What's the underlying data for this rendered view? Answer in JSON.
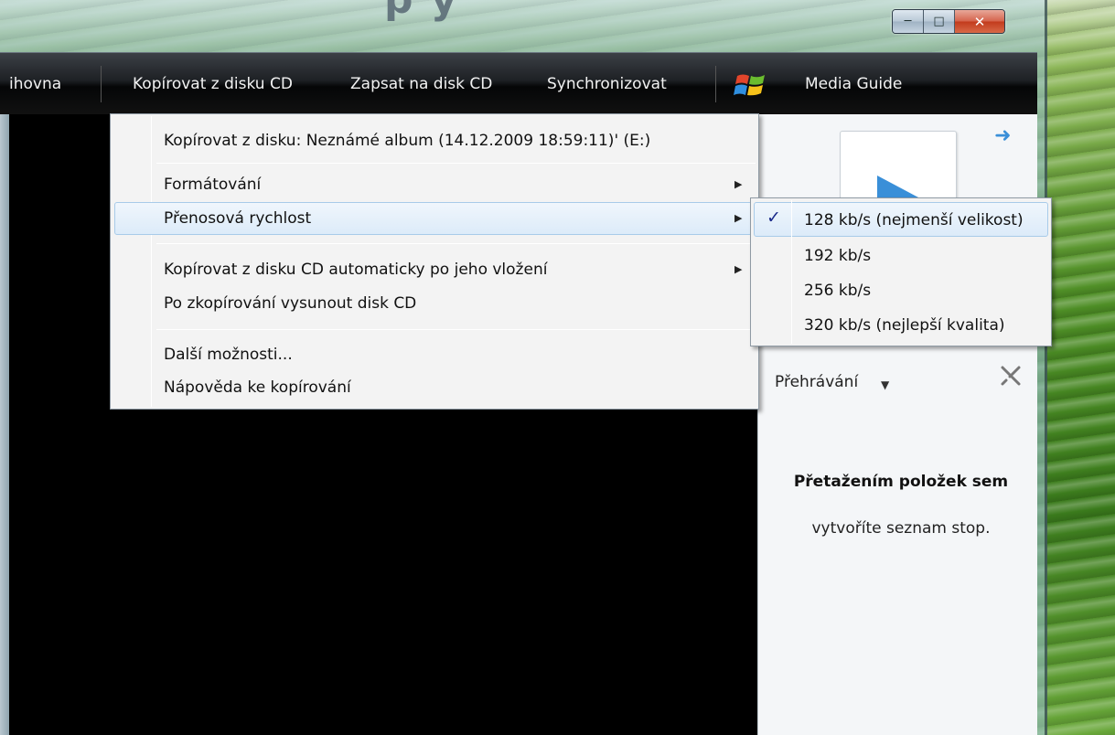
{
  "banner": {
    "title": "p  y"
  },
  "window": {
    "controls": {
      "minimize_icon": "minimize-icon",
      "maximize_icon": "maximize-icon",
      "close_icon": "close-icon"
    }
  },
  "toolbar": {
    "items": [
      {
        "label": "ihovna"
      },
      {
        "label": "Kopírovat z disku CD"
      },
      {
        "label": "Zapsat na disk CD"
      },
      {
        "label": "Synchronizovat"
      },
      {
        "label": "Media Guide"
      }
    ]
  },
  "rip_menu": {
    "items": [
      {
        "label": "Kopírovat z disku: Neznámé album (14.12.2009 18:59:11)' (E:)",
        "has_submenu": false
      },
      {
        "label": "Formátování",
        "has_submenu": true
      },
      {
        "label": "Přenosová rychlost",
        "has_submenu": true,
        "highlighted": true
      },
      {
        "label": "Kopírovat z disku CD automaticky po jeho vložení",
        "has_submenu": true
      },
      {
        "label": "Po zkopírování vysunout disk CD",
        "has_submenu": false
      },
      {
        "label": "Další možnosti...",
        "has_submenu": false
      },
      {
        "label": "Nápověda ke kopírování",
        "has_submenu": false
      }
    ]
  },
  "bitrate_submenu": {
    "items": [
      {
        "label": "128 kb/s (nejmenší velikost)",
        "checked": true
      },
      {
        "label": "192 kb/s",
        "checked": false
      },
      {
        "label": "256 kb/s",
        "checked": false
      },
      {
        "label": "320 kb/s (nejlepší kvalita)",
        "checked": false
      }
    ]
  },
  "right_pane": {
    "playlist_heading": "Přehrávání",
    "empty_bold": "Přetažením položek sem",
    "empty_hint": "vytvoříte seznam stop."
  },
  "colors": {
    "menu_highlight": "#dcebf9",
    "checkmark": "#1b2a8a",
    "toolbar": "#111111"
  }
}
